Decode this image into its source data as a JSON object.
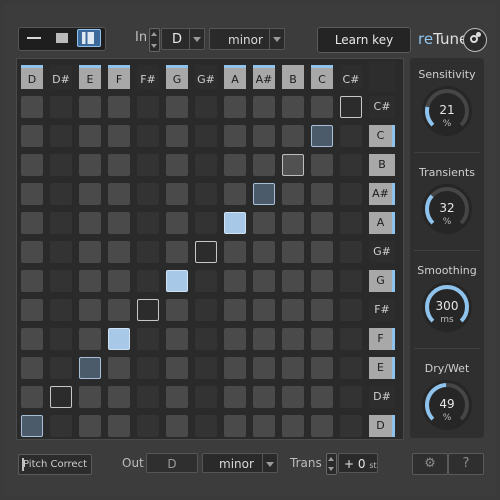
{
  "topbar": {
    "in_label": "In",
    "key": "D",
    "scale": "minor",
    "learn_key": "Learn key",
    "logo_prefix": "re",
    "logo_suffix": "Tune"
  },
  "columns": [
    {
      "note": "D",
      "shade": "light",
      "accent": true
    },
    {
      "note": "D#",
      "shade": "dark",
      "accent": false
    },
    {
      "note": "E",
      "shade": "light",
      "accent": true
    },
    {
      "note": "F",
      "shade": "light",
      "accent": true
    },
    {
      "note": "F#",
      "shade": "dark",
      "accent": false
    },
    {
      "note": "G",
      "shade": "light",
      "accent": true
    },
    {
      "note": "G#",
      "shade": "dark",
      "accent": false
    },
    {
      "note": "A",
      "shade": "light",
      "accent": true
    },
    {
      "note": "A#",
      "shade": "light",
      "accent": true
    },
    {
      "note": "B",
      "shade": "light",
      "accent": false
    },
    {
      "note": "C",
      "shade": "light",
      "accent": true
    },
    {
      "note": "C#",
      "shade": "dark",
      "accent": false
    }
  ],
  "rows": [
    {
      "note": "C#",
      "shade": "dark",
      "accent": false,
      "on_col": 11,
      "on_style": "outline"
    },
    {
      "note": "C",
      "shade": "light",
      "accent": true,
      "on_col": 10,
      "on_style": "dark"
    },
    {
      "note": "B",
      "shade": "light",
      "accent": false,
      "on_col": 9,
      "on_style": "mid"
    },
    {
      "note": "A#",
      "shade": "light",
      "accent": true,
      "on_col": 8,
      "on_style": "dark"
    },
    {
      "note": "A",
      "shade": "light",
      "accent": true,
      "on_col": 7,
      "on_style": "light"
    },
    {
      "note": "G#",
      "shade": "dark",
      "accent": false,
      "on_col": 6,
      "on_style": "outline"
    },
    {
      "note": "G",
      "shade": "light",
      "accent": true,
      "on_col": 5,
      "on_style": "light"
    },
    {
      "note": "F#",
      "shade": "dark",
      "accent": false,
      "on_col": 4,
      "on_style": "outline"
    },
    {
      "note": "F",
      "shade": "light",
      "accent": true,
      "on_col": 3,
      "on_style": "light"
    },
    {
      "note": "E",
      "shade": "light",
      "accent": true,
      "on_col": 2,
      "on_style": "dark"
    },
    {
      "note": "D#",
      "shade": "dark",
      "accent": false,
      "on_col": 1,
      "on_style": "outline"
    },
    {
      "note": "D",
      "shade": "light",
      "accent": true,
      "on_col": 0,
      "on_style": "dark"
    }
  ],
  "knobs": [
    {
      "title": "Sensitivity",
      "value": "21",
      "unit": "%",
      "fraction": 0.21
    },
    {
      "title": "Transients",
      "value": "32",
      "unit": "%",
      "fraction": 0.32
    },
    {
      "title": "Smoothing",
      "value": "300",
      "unit": "ms",
      "fraction": 1.0
    },
    {
      "title": "Dry/Wet",
      "value": "49",
      "unit": "%",
      "fraction": 0.49
    }
  ],
  "bottom": {
    "pitch_correct": "Pitch Correct",
    "out_label": "Out",
    "out_key": "D",
    "out_scale": "minor",
    "trans_label": "Trans",
    "trans_value": "+ 0",
    "trans_unit": "st",
    "gear_glyph": "⚙",
    "help_glyph": "?"
  },
  "colors": {
    "accent": "#8ec3ed",
    "background": "#3a3a3a"
  }
}
